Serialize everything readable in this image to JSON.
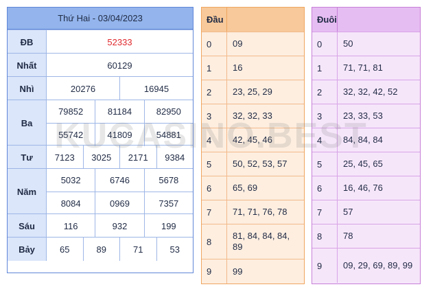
{
  "results": {
    "title": "Thứ Hai - 03/04/2023",
    "rows": [
      {
        "label": "ĐB",
        "lines": [
          [
            "52333"
          ]
        ]
      },
      {
        "label": "Nhất",
        "lines": [
          [
            "60129"
          ]
        ]
      },
      {
        "label": "Nhì",
        "lines": [
          [
            "20276",
            "16945"
          ]
        ]
      },
      {
        "label": "Ba",
        "lines": [
          [
            "79852",
            "81184",
            "82950"
          ],
          [
            "55742",
            "41809",
            "54881"
          ]
        ]
      },
      {
        "label": "Tư",
        "lines": [
          [
            "7123",
            "3025",
            "2171",
            "9384"
          ]
        ]
      },
      {
        "label": "Năm",
        "lines": [
          [
            "5032",
            "6746",
            "5678"
          ],
          [
            "8084",
            "0969",
            "7357"
          ]
        ]
      },
      {
        "label": "Sáu",
        "lines": [
          [
            "116",
            "932",
            "199"
          ]
        ]
      },
      {
        "label": "Bảy",
        "lines": [
          [
            "65",
            "89",
            "71",
            "53"
          ]
        ]
      }
    ]
  },
  "dau": {
    "header": "Đầu",
    "rows": [
      {
        "key": "0",
        "value": "09"
      },
      {
        "key": "1",
        "value": "16"
      },
      {
        "key": "2",
        "value": "23, 25, 29"
      },
      {
        "key": "3",
        "value": "32, 32, 33"
      },
      {
        "key": "4",
        "value": "42, 45, 46"
      },
      {
        "key": "5",
        "value": "50, 52, 53, 57"
      },
      {
        "key": "6",
        "value": "65, 69"
      },
      {
        "key": "7",
        "value": "71, 71, 76, 78"
      },
      {
        "key": "8",
        "value": "81, 84, 84, 84, 89"
      },
      {
        "key": "9",
        "value": "99"
      }
    ]
  },
  "duoi": {
    "header": "Đuôi",
    "rows": [
      {
        "key": "0",
        "value": "50"
      },
      {
        "key": "1",
        "value": "71, 71, 81"
      },
      {
        "key": "2",
        "value": "32, 32, 42, 52"
      },
      {
        "key": "3",
        "value": "23, 33, 53"
      },
      {
        "key": "4",
        "value": "84, 84, 84"
      },
      {
        "key": "5",
        "value": "25, 45, 65"
      },
      {
        "key": "6",
        "value": "16, 46, 76"
      },
      {
        "key": "7",
        "value": "57"
      },
      {
        "key": "8",
        "value": "78"
      },
      {
        "key": "9",
        "value": "09, 29, 69, 89, 99"
      }
    ]
  },
  "watermark": "KUCASINO.BEST",
  "colors": {
    "special_prize": "#e0282c",
    "results_accent": "#93b4ec",
    "dau_accent": "#f8c99a",
    "duoi_accent": "#e6bdf2"
  }
}
